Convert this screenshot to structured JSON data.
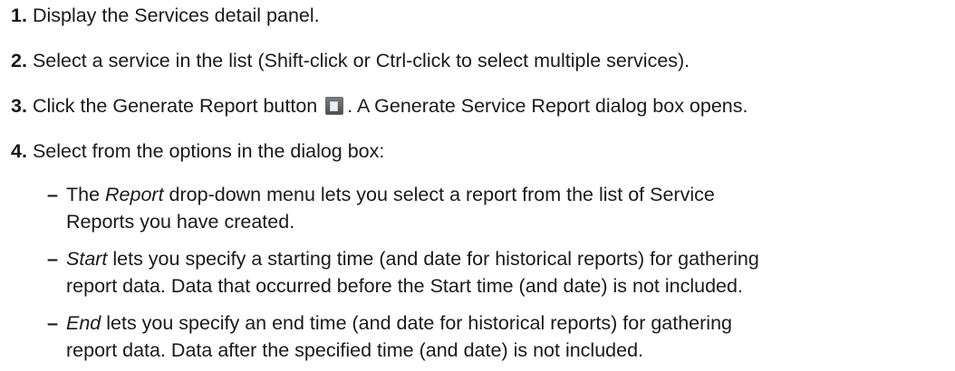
{
  "steps": [
    {
      "number": "1.",
      "text": "Display the Services detail panel."
    },
    {
      "number": "2.",
      "text": "Select a service in the list (Shift-click or Ctrl-click to select multiple services)."
    },
    {
      "number": "3.",
      "text_before": "Click the Generate Report button",
      "icon": "generate-report-icon",
      "text_after": ". A Generate Service Report dialog box opens."
    },
    {
      "number": "4.",
      "text": "Select from the options in the dialog box:"
    }
  ],
  "options": [
    {
      "dash": "–",
      "term": "Report",
      "line1_rest": " drop-down menu lets you select a report from the list of Service",
      "line2": "Reports you have created."
    },
    {
      "dash": "–",
      "term": "Start",
      "line1_rest": " lets you specify a starting time (and date for historical reports) for gathering",
      "line2": "report data. Data that occurred before the Start time (and date) is not included."
    },
    {
      "dash": "–",
      "term": "End",
      "line1_rest": " lets you specify an end time (and date for historical reports) for gathering",
      "line2": "report data. Data after the specified time (and date) is not included."
    }
  ],
  "option_prefix": "The "
}
